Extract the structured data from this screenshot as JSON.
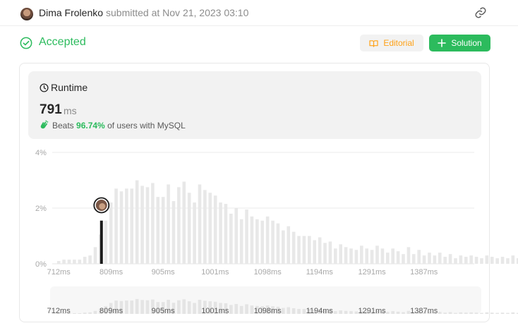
{
  "header": {
    "username": "Dima Frolenko",
    "submitted_text": "submitted at Nov 21, 2023 03:10",
    "icons": {
      "avatar": "user-avatar",
      "link": "link-icon"
    }
  },
  "status": {
    "label": "Accepted",
    "icon": "check-circle-icon",
    "color": "#2cbb5d"
  },
  "buttons": {
    "editorial": {
      "label": "Editorial",
      "icon": "book-icon",
      "color": "#ffa116"
    },
    "solution": {
      "label": "Solution",
      "icon": "plus-icon",
      "color": "#2cbb5d"
    }
  },
  "runtime": {
    "title": "Runtime",
    "icon": "clock-icon",
    "value": "791",
    "unit": "ms",
    "beats_label": "Beats",
    "beats_percent": "96.74%",
    "beats_suffix": "of users with MySQL",
    "beats_icon": "clapping-hands-icon"
  },
  "chart_data": {
    "type": "bar",
    "title": "",
    "xlabel": "",
    "ylabel": "",
    "x_ticks": [
      "712ms",
      "809ms",
      "905ms",
      "1001ms",
      "1098ms",
      "1194ms",
      "1291ms",
      "1387ms"
    ],
    "y_ticks": [
      "0%",
      "2%",
      "4%"
    ],
    "ylim": [
      0,
      4
    ],
    "xlim": [
      700,
      1480
    ],
    "bin_width_ms": 9.65,
    "x_start_ms": 712,
    "grid": true,
    "highlight": {
      "runtime_ms": 791,
      "percent": 1.55,
      "marker": "user-avatar"
    },
    "values": [
      0.1,
      0.15,
      0.15,
      0.15,
      0.15,
      0.25,
      0.3,
      0.6,
      1.05,
      1.55,
      2.2,
      2.7,
      2.6,
      2.7,
      2.7,
      3.0,
      2.8,
      2.75,
      2.9,
      2.4,
      2.4,
      2.85,
      2.25,
      2.75,
      2.95,
      2.55,
      2.2,
      2.85,
      2.65,
      2.55,
      2.45,
      2.2,
      2.15,
      1.8,
      2.0,
      1.6,
      1.95,
      1.7,
      1.6,
      1.55,
      1.7,
      1.55,
      1.45,
      1.2,
      1.35,
      1.15,
      1.0,
      1.0,
      1.0,
      0.85,
      0.95,
      0.75,
      0.8,
      0.55,
      0.7,
      0.6,
      0.55,
      0.5,
      0.65,
      0.55,
      0.5,
      0.65,
      0.55,
      0.4,
      0.55,
      0.45,
      0.35,
      0.6,
      0.35,
      0.5,
      0.3,
      0.4,
      0.3,
      0.4,
      0.25,
      0.35,
      0.2,
      0.3,
      0.25,
      0.3,
      0.25,
      0.2,
      0.3,
      0.25,
      0.2,
      0.25,
      0.2,
      0.3,
      0.2,
      0.25,
      0.25,
      0.2
    ]
  }
}
